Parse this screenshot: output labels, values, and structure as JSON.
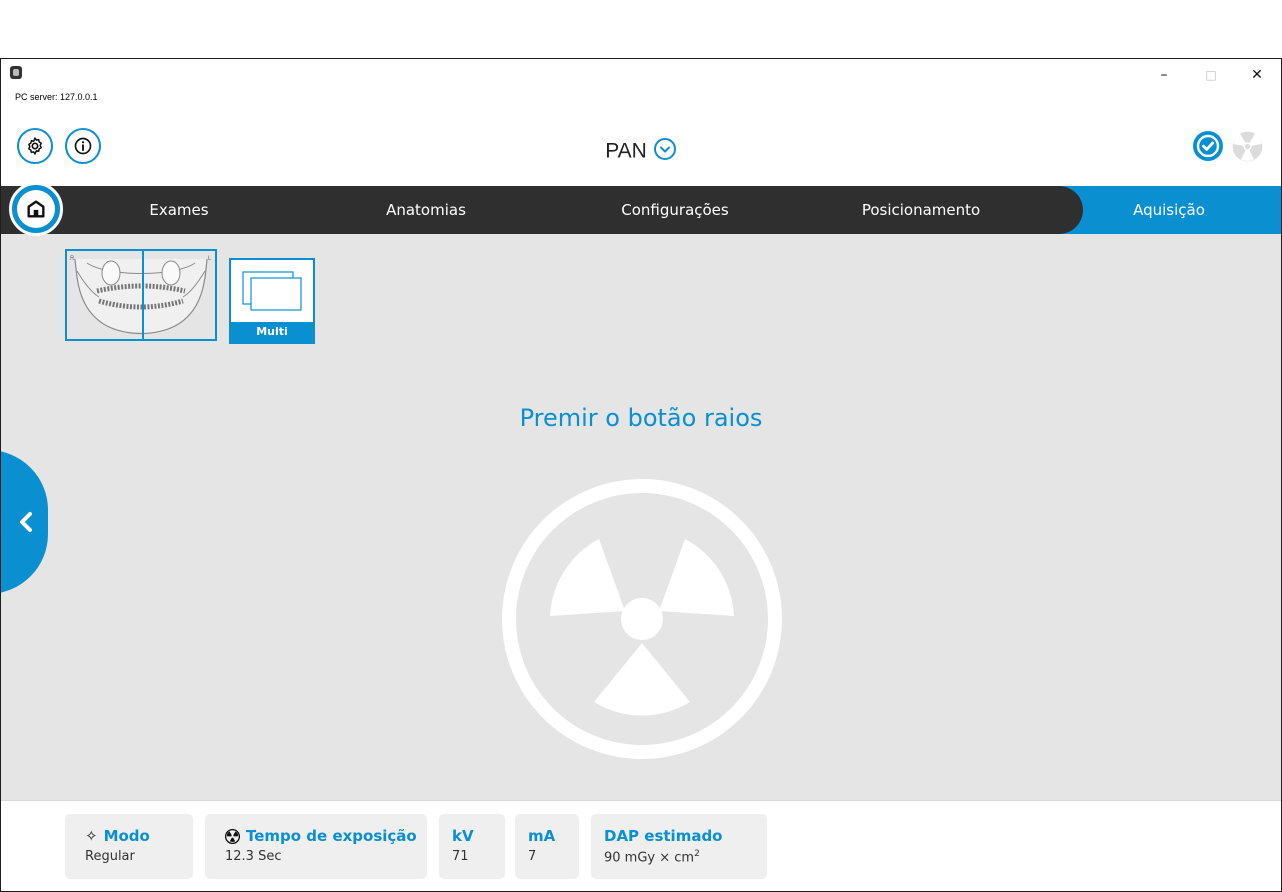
{
  "titlebar": {
    "server_label": "PC server: 127.0.0.1",
    "minimize_label": "–",
    "maximize_label": "□",
    "close_label": "✕"
  },
  "header": {
    "exam_title": "PAN"
  },
  "nav": {
    "items": [
      {
        "label": "Exames"
      },
      {
        "label": "Anatomias"
      },
      {
        "label": "Configurações"
      },
      {
        "label": "Posicionamento"
      },
      {
        "label": "Aquisição"
      }
    ],
    "active": "Aquisição"
  },
  "thumbnails": {
    "pan_left_marker": "R",
    "pan_right_marker": "L",
    "multi_label": "Multi"
  },
  "main": {
    "prompt": "Premir o botão raios"
  },
  "footer": {
    "mode_title": "Modo",
    "mode_value": "Regular",
    "exposure_title": "Tempo de exposição",
    "exposure_value": "12.3 Sec",
    "kv_title": "kV",
    "kv_value": "71",
    "ma_title": "mA",
    "ma_value": "7",
    "dap_title": "DAP estimado",
    "dap_value": "90 mGy × cm",
    "dap_exponent": "2"
  },
  "colors": {
    "accent": "#0a8fd1",
    "nav_dark": "#2f2f2f",
    "content_bg": "#e5e5e5"
  }
}
